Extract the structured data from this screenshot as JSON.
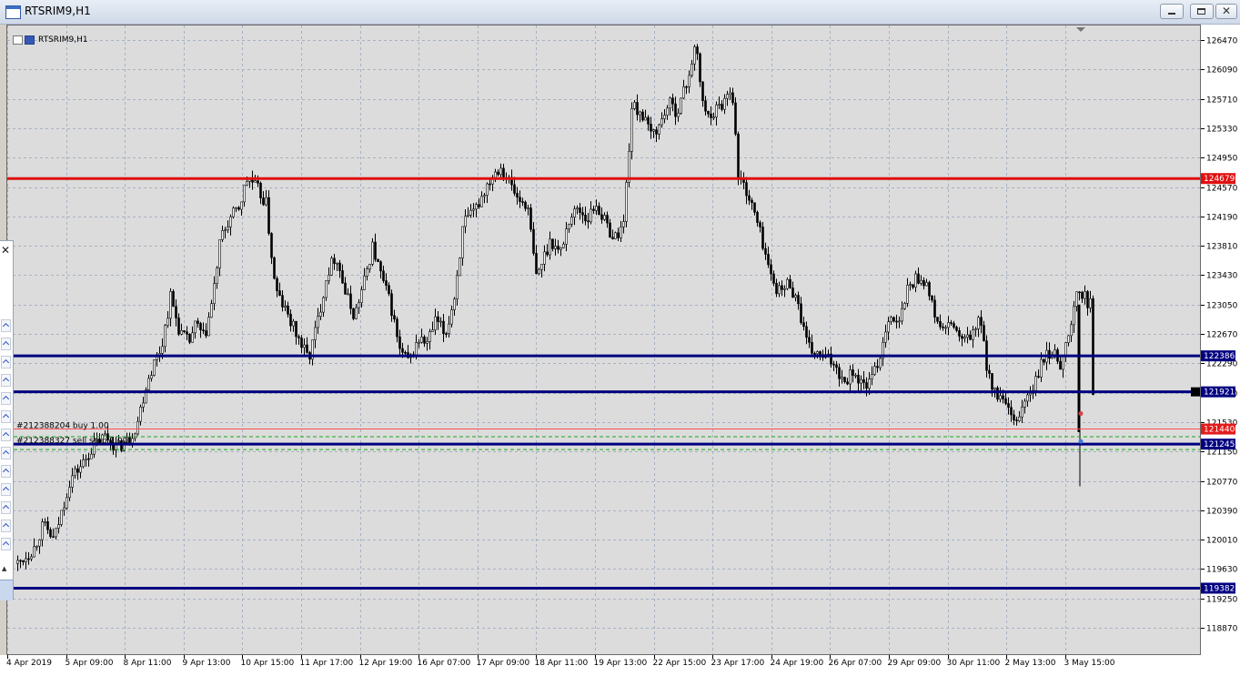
{
  "window": {
    "title": "RTSRIM9,H1"
  },
  "chart_label": "RTSRIM9,H1",
  "colors": {
    "background": "#dcdcdc",
    "grid": "#a8b2c2",
    "support_line": "#000080",
    "resistance_line": "#e01010",
    "candles": "#000000",
    "order_line": "#ff5050",
    "stop_line": "#19a819"
  },
  "chart_data": {
    "type": "candlestick",
    "symbol": "RTSRIM9",
    "timeframe": "H1",
    "ylim": [
      118596,
      126682
    ],
    "price_ticks": [
      126470,
      126090,
      125710,
      125330,
      124950,
      124570,
      124190,
      123810,
      123430,
      123050,
      122670,
      122290,
      121910,
      121530,
      121150,
      120770,
      120390,
      120010,
      119630,
      119250,
      118870
    ],
    "time_ticks": [
      "4 Apr 2019",
      "5 Apr 09:00",
      "8 Apr 11:00",
      "9 Apr 13:00",
      "10 Apr 15:00",
      "11 Apr 17:00",
      "12 Apr 19:00",
      "16 Apr 07:00",
      "17 Apr 09:00",
      "18 Apr 11:00",
      "19 Apr 13:00",
      "22 Apr 15:00",
      "23 Apr 17:00",
      "24 Apr 19:00",
      "26 Apr 07:00",
      "29 Apr 09:00",
      "30 Apr 11:00",
      "2 May 13:00",
      "3 May 15:00"
    ],
    "close_path": [
      [
        0,
        119700
      ],
      [
        18,
        119900
      ],
      [
        28,
        120200
      ],
      [
        40,
        120000
      ],
      [
        50,
        120450
      ],
      [
        58,
        120800
      ],
      [
        72,
        121000
      ],
      [
        82,
        121200
      ],
      [
        96,
        121350
      ],
      [
        110,
        121200
      ],
      [
        122,
        121300
      ],
      [
        131,
        121500
      ],
      [
        142,
        122050
      ],
      [
        150,
        122300
      ],
      [
        158,
        122500
      ],
      [
        168,
        123150
      ],
      [
        178,
        122700
      ],
      [
        188,
        122550
      ],
      [
        196,
        122800
      ],
      [
        205,
        122600
      ],
      [
        214,
        123100
      ],
      [
        223,
        123900
      ],
      [
        233,
        124150
      ],
      [
        243,
        124300
      ],
      [
        253,
        124700
      ],
      [
        263,
        124550
      ],
      [
        273,
        124350
      ],
      [
        283,
        123250
      ],
      [
        293,
        123000
      ],
      [
        303,
        122750
      ],
      [
        313,
        122500
      ],
      [
        320,
        122350
      ],
      [
        330,
        122850
      ],
      [
        340,
        123450
      ],
      [
        350,
        123700
      ],
      [
        360,
        123200
      ],
      [
        370,
        122900
      ],
      [
        380,
        123300
      ],
      [
        390,
        123800
      ],
      [
        400,
        123400
      ],
      [
        410,
        123050
      ],
      [
        420,
        122450
      ],
      [
        430,
        122300
      ],
      [
        440,
        122600
      ],
      [
        450,
        122550
      ],
      [
        460,
        122850
      ],
      [
        470,
        122650
      ],
      [
        480,
        123150
      ],
      [
        490,
        124100
      ],
      [
        500,
        124200
      ],
      [
        510,
        124450
      ],
      [
        520,
        124700
      ],
      [
        530,
        124850
      ],
      [
        540,
        124650
      ],
      [
        550,
        124400
      ],
      [
        560,
        124350
      ],
      [
        570,
        123400
      ],
      [
        578,
        123650
      ],
      [
        586,
        123900
      ],
      [
        596,
        123700
      ],
      [
        606,
        124150
      ],
      [
        616,
        124300
      ],
      [
        626,
        124150
      ],
      [
        636,
        124350
      ],
      [
        646,
        124100
      ],
      [
        656,
        123900
      ],
      [
        666,
        124100
      ],
      [
        675,
        125600
      ],
      [
        685,
        125550
      ],
      [
        695,
        125250
      ],
      [
        705,
        125350
      ],
      [
        715,
        125650
      ],
      [
        725,
        125550
      ],
      [
        735,
        125900
      ],
      [
        745,
        126400
      ],
      [
        755,
        125500
      ],
      [
        765,
        125550
      ],
      [
        775,
        125650
      ],
      [
        785,
        125900
      ],
      [
        792,
        124700
      ],
      [
        800,
        124550
      ],
      [
        808,
        124300
      ],
      [
        818,
        123900
      ],
      [
        828,
        123400
      ],
      [
        838,
        123200
      ],
      [
        848,
        123350
      ],
      [
        858,
        123050
      ],
      [
        868,
        122500
      ],
      [
        878,
        122400
      ],
      [
        888,
        122350
      ],
      [
        898,
        122300
      ],
      [
        908,
        122050
      ],
      [
        918,
        122200
      ],
      [
        928,
        122000
      ],
      [
        938,
        122050
      ],
      [
        948,
        122400
      ],
      [
        958,
        122950
      ],
      [
        968,
        122750
      ],
      [
        978,
        123250
      ],
      [
        988,
        123400
      ],
      [
        998,
        123350
      ],
      [
        1008,
        122900
      ],
      [
        1018,
        122700
      ],
      [
        1028,
        122800
      ],
      [
        1038,
        122550
      ],
      [
        1048,
        122650
      ],
      [
        1058,
        122850
      ],
      [
        1066,
        122200
      ],
      [
        1074,
        121900
      ],
      [
        1086,
        121750
      ],
      [
        1096,
        121450
      ],
      [
        1106,
        121800
      ],
      [
        1116,
        121950
      ],
      [
        1126,
        122300
      ],
      [
        1136,
        122450
      ],
      [
        1146,
        122300
      ],
      [
        1156,
        122650
      ],
      [
        1164,
        123200
      ],
      [
        1172,
        123150
      ],
      [
        1179,
        123050
      ],
      [
        1183,
        121600
      ],
      [
        1185,
        121400
      ]
    ],
    "horizontal_levels": [
      {
        "price": 124679,
        "label": "124679",
        "color": "red",
        "kind": "resistance"
      },
      {
        "price": 122386,
        "label": "122386",
        "color": "navy",
        "kind": "support"
      },
      {
        "price": 121921,
        "label": "121921",
        "color": "navy",
        "kind": "support"
      },
      {
        "price": 121245,
        "label": "121245",
        "color": "navy",
        "kind": "support"
      },
      {
        "price": 119382,
        "label": "119382",
        "color": "navy",
        "kind": "support"
      }
    ],
    "order_lines": [
      {
        "price": 121440,
        "text": "#212388204 buy 1.00",
        "axis_label": "121440"
      },
      {
        "price": 121245,
        "text": "#212388327 sell stop 1.00"
      }
    ],
    "current_price": 121440
  }
}
